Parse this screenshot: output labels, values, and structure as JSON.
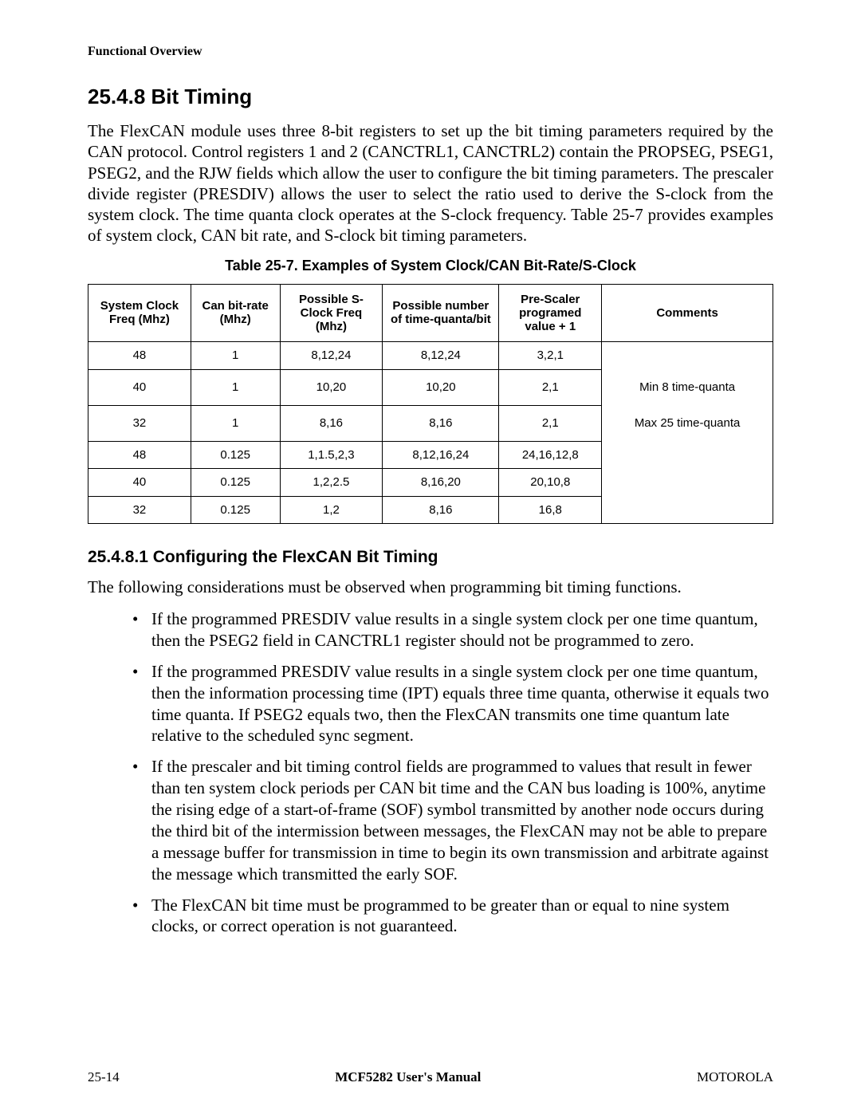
{
  "running_head": "Functional Overview",
  "section_heading": "25.4.8  Bit Timing",
  "intro_paragraph": "The FlexCAN module uses three 8-bit registers to set up the bit timing parameters required by the CAN protocol. Control registers 1 and 2 (CANCTRL1, CANCTRL2) contain the PROPSEG, PSEG1, PSEG2, and the RJW fields which allow the user to configure the bit timing parameters. The prescaler divide register (PRESDIV) allows the user to select the ratio used to derive the S-clock from the system clock. The time quanta clock operates at the S-clock frequency. Table 25-7 provides examples of system clock, CAN bit rate, and S-clock bit timing parameters.",
  "table_caption": "Table 25-7. Examples of System Clock/CAN Bit-Rate/S-Clock",
  "table": {
    "headers": {
      "c0": "System Clock Freq (Mhz)",
      "c1": "Can bit-rate (Mhz)",
      "c2": "Possible S-Clock Freq (Mhz)",
      "c3": "Possible number of time-quanta/bit",
      "c4": "Pre-Scaler programed value + 1",
      "c5": "Comments"
    },
    "rows": [
      {
        "c0": "48",
        "c1": "1",
        "c2": "8,12,24",
        "c3": "8,12,24",
        "c4": "3,2,1"
      },
      {
        "c0": "40",
        "c1": "1",
        "c2": "10,20",
        "c3": "10,20",
        "c4": "2,1"
      },
      {
        "c0": "32",
        "c1": "1",
        "c2": "8,16",
        "c3": "8,16",
        "c4": "2,1"
      },
      {
        "c0": "48",
        "c1": "0.125",
        "c2": "1,1.5,2,3",
        "c3": "8,12,16,24",
        "c4": "24,16,12,8"
      },
      {
        "c0": "40",
        "c1": "0.125",
        "c2": "1,2,2.5",
        "c3": "8,16,20",
        "c4": "20,10,8"
      },
      {
        "c0": "32",
        "c1": "0.125",
        "c2": "1,2",
        "c3": "8,16",
        "c4": "16,8"
      }
    ],
    "comment_line1": "Min 8 time-quanta",
    "comment_line2": "Max 25 time-quanta"
  },
  "subsection_heading": "25.4.8.1  Configuring the FlexCAN Bit Timing",
  "subsection_intro": "The following considerations must be observed when programming bit timing functions.",
  "bullets": [
    "If the programmed PRESDIV value results in a single system clock per one time quantum, then the PSEG2 field in CANCTRL1 register should not be programmed to zero.",
    "If the programmed PRESDIV value results in a single system clock per one time quantum, then the information processing time (IPT) equals three time quanta, otherwise it equals two time quanta. If PSEG2 equals two, then the FlexCAN transmits one time quantum late relative to the scheduled sync segment.",
    "If the prescaler and bit timing control fields are programmed to values that result in fewer than ten system clock periods per CAN bit time and the CAN bus loading is 100%, anytime the rising edge of a start-of-frame (SOF) symbol transmitted by another node occurs during the third bit of the intermission between messages, the FlexCAN may not be able to prepare a message buffer for transmission in time to begin its own transmission and arbitrate against the message which transmitted the early SOF.",
    "The FlexCAN bit time must be programmed to be greater than or equal to nine system clocks, or correct operation is not guaranteed."
  ],
  "footer": {
    "left": "25-14",
    "center": "MCF5282 User's Manual",
    "right": "MOTOROLA"
  }
}
